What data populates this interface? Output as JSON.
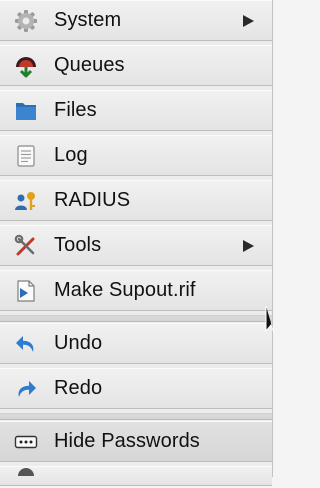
{
  "menu": {
    "items": [
      {
        "label": "System",
        "icon": "gear-icon",
        "submenu": true
      },
      {
        "label": "Queues",
        "icon": "queues-icon",
        "submenu": false
      },
      {
        "label": "Files",
        "icon": "folder-icon",
        "submenu": false
      },
      {
        "label": "Log",
        "icon": "log-document-icon",
        "submenu": false
      },
      {
        "label": "RADIUS",
        "icon": "user-key-icon",
        "submenu": false
      },
      {
        "label": "Tools",
        "icon": "tools-icon",
        "submenu": true
      },
      {
        "label": "Make Supout.rif",
        "icon": "supout-file-icon",
        "submenu": false
      },
      {
        "label": "Undo",
        "icon": "undo-arrow-icon",
        "submenu": false
      },
      {
        "label": "Redo",
        "icon": "redo-arrow-icon",
        "submenu": false
      },
      {
        "label": "Hide Passwords",
        "icon": "hide-passwords-icon",
        "submenu": false
      }
    ]
  },
  "colors": {
    "menu_background": "#ececec",
    "highlight_background": "#dcdcdc",
    "text": "#111111",
    "icon_blue": "#2b6fb6"
  }
}
